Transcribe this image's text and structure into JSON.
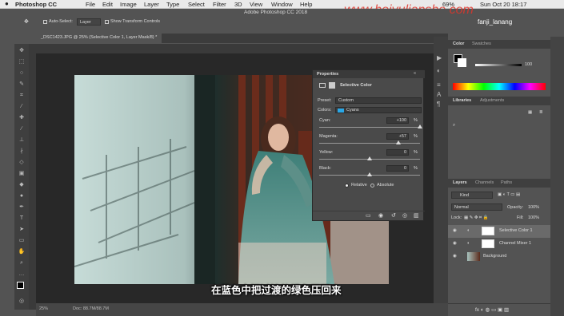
{
  "menubar": {
    "app_name": "Photoshop CC",
    "items": [
      "File",
      "Edit",
      "Image",
      "Layer",
      "Type",
      "Select",
      "Filter",
      "3D",
      "View",
      "Window",
      "Help"
    ],
    "window_title": "Adobe Photoshop CC 2018",
    "battery": "69%",
    "clock": "Sun Oct 20  18:17"
  },
  "watermark": "www.heiyulianshe.com",
  "options_bar": {
    "auto_select_label": "Auto-Select:",
    "auto_select_value": "Layer",
    "transform_label": "Show Transform Controls"
  },
  "user": "fanji_lanang",
  "document_tab": "_DSC1423.JPG @ 25% (Selective Color 1, Layer Mask/8) *",
  "status": {
    "zoom": "25%",
    "doc": "Doc: 88.7M/88.7M"
  },
  "subtitle": "在蓝色中把过渡的绿色压回来",
  "properties": {
    "title": "Properties",
    "adjustment": "Selective Color",
    "preset_label": "Preset:",
    "preset_value": "Custom",
    "colors_label": "Colors:",
    "colors_value": "Cyans",
    "swatch_color": "#2aa7e6",
    "sliders": [
      {
        "label": "Cyan:",
        "value": "+100",
        "unit": "%",
        "fraction": 1.0
      },
      {
        "label": "Magenta:",
        "value": "+57",
        "unit": "%",
        "fraction": 0.785
      },
      {
        "label": "Yellow:",
        "value": "0",
        "unit": "%",
        "fraction": 0.5
      },
      {
        "label": "Black:",
        "value": "0",
        "unit": "%",
        "fraction": 0.5
      }
    ],
    "relative_label": "Relative",
    "absolute_label": "Absolute",
    "mode": "Relative"
  },
  "color_panel": {
    "tabs": [
      "Color",
      "Swatches"
    ],
    "k_value": "100"
  },
  "libraries_panel": {
    "tabs": [
      "Libraries",
      "Adjustments"
    ]
  },
  "layers_panel": {
    "tabs": [
      "Layers",
      "Channels",
      "Paths"
    ],
    "kind_label": "Kind",
    "blend_mode": "Normal",
    "opacity_label": "Opacity:",
    "opacity_value": "100%",
    "lock_label": "Lock:",
    "fill_label": "Fill:",
    "fill_value": "100%",
    "layers": [
      {
        "name": "Selective Color 1"
      },
      {
        "name": "Channel Mixer 1"
      },
      {
        "name": "Background"
      }
    ]
  }
}
